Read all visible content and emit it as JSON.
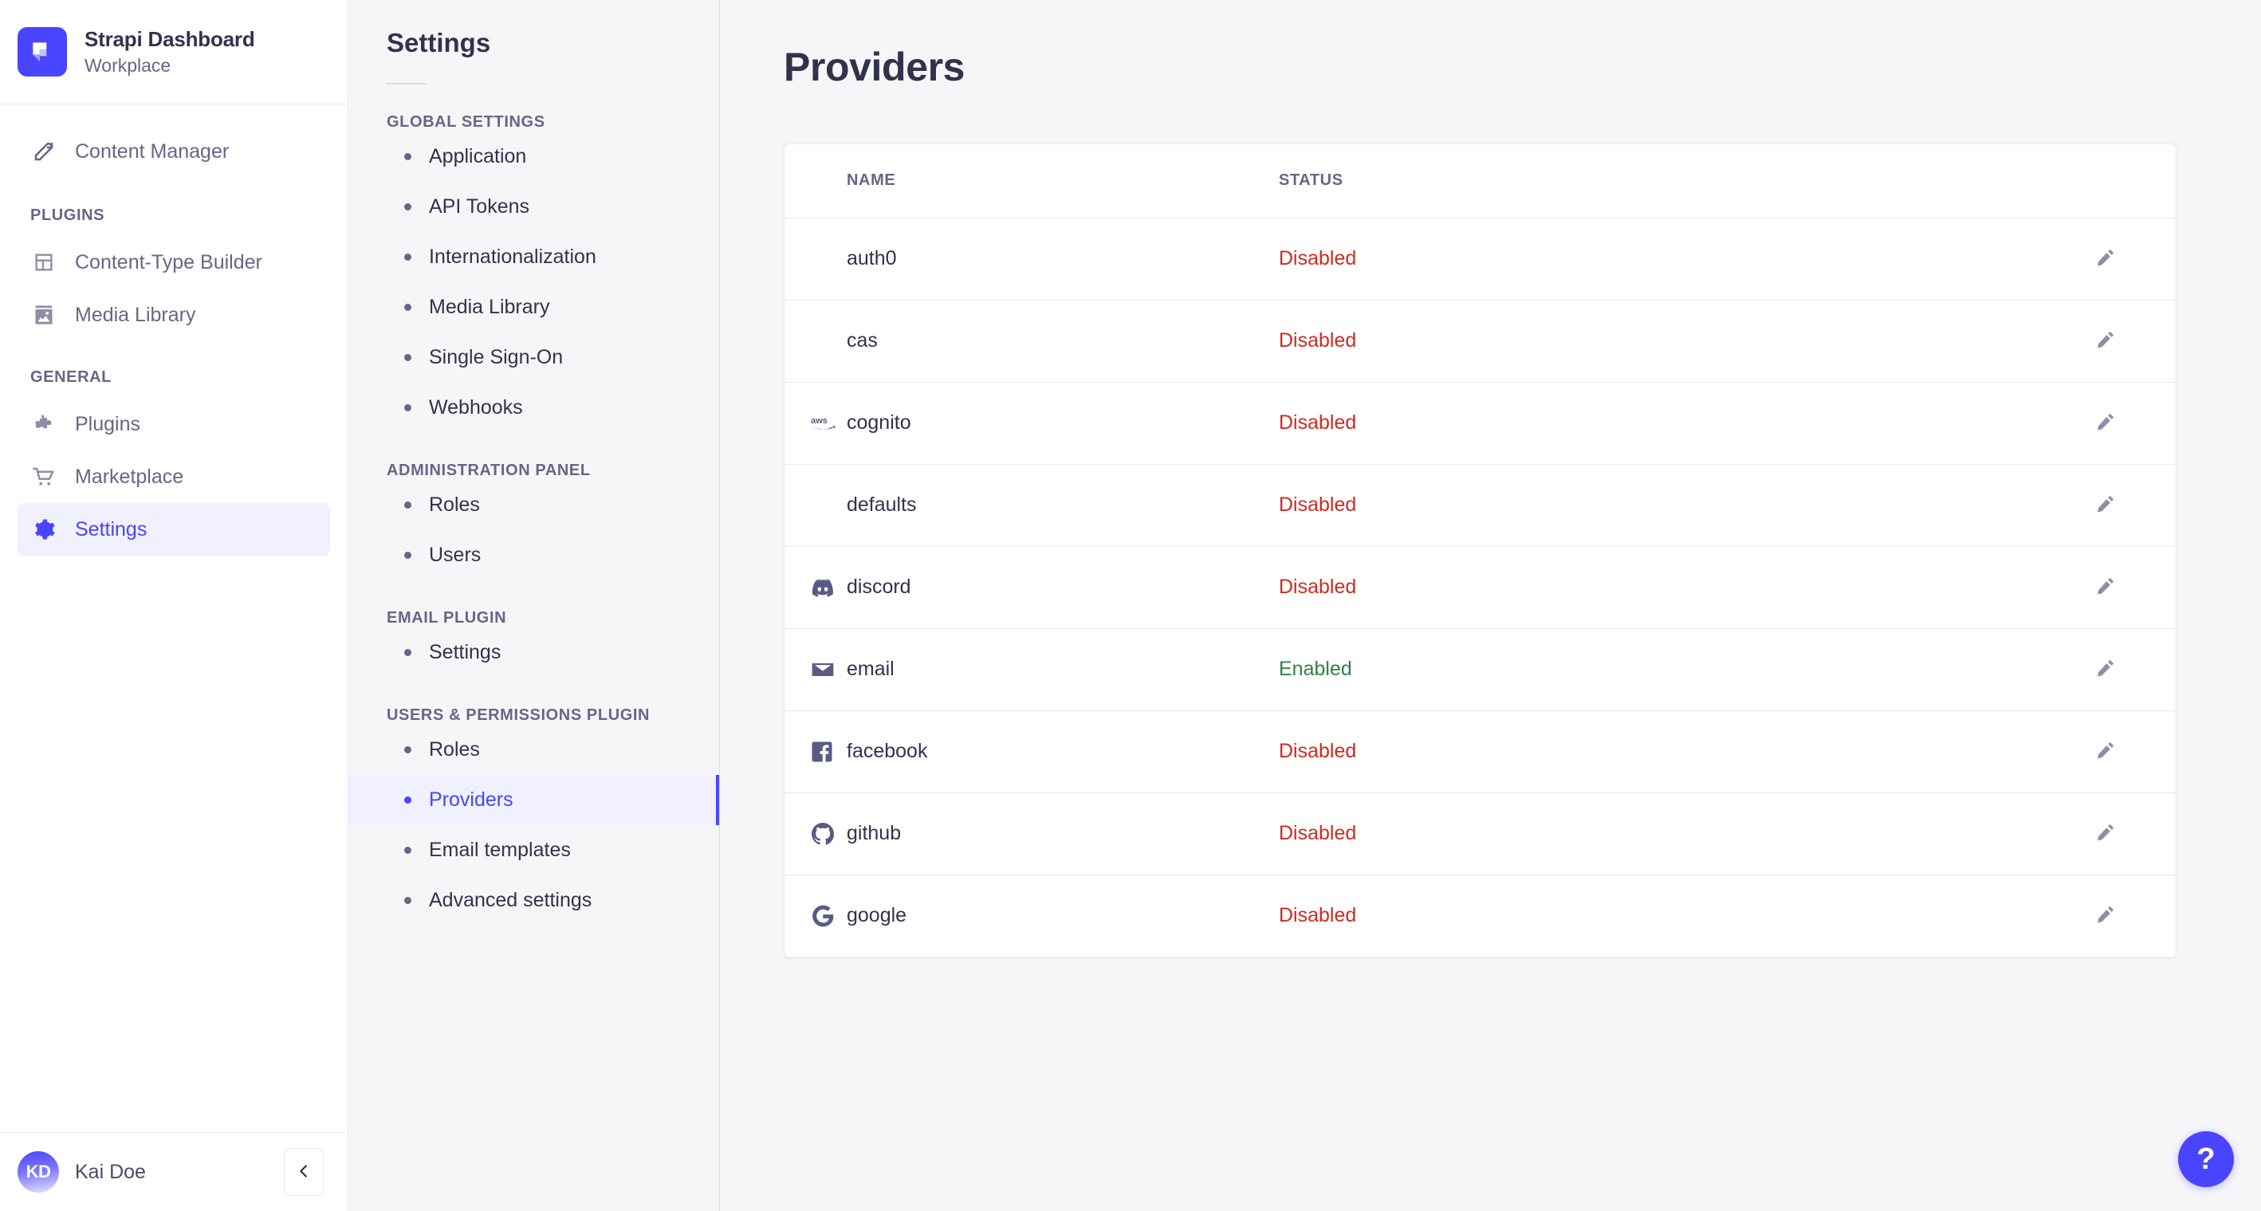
{
  "brand": {
    "title": "Strapi Dashboard",
    "subtitle": "Workplace",
    "logo_color": "#4945ff"
  },
  "sidebar": {
    "main_items": [
      {
        "label": "Content Manager",
        "icon": "feather-pen-icon",
        "active": false
      }
    ],
    "groups": [
      {
        "label": "PLUGINS",
        "items": [
          {
            "label": "Content-Type Builder",
            "icon": "layout-grid-icon",
            "active": false
          },
          {
            "label": "Media Library",
            "icon": "image-icon",
            "active": false
          }
        ]
      },
      {
        "label": "GENERAL",
        "items": [
          {
            "label": "Plugins",
            "icon": "puzzle-icon",
            "active": false
          },
          {
            "label": "Marketplace",
            "icon": "shopping-cart-icon",
            "active": false
          },
          {
            "label": "Settings",
            "icon": "gear-icon",
            "active": true
          }
        ]
      }
    ],
    "user": {
      "initials": "KD",
      "name": "Kai Doe"
    },
    "collapse_icon": "chevron-left-icon"
  },
  "subnav": {
    "title": "Settings",
    "groups": [
      {
        "label": "GLOBAL SETTINGS",
        "items": [
          {
            "label": "Application",
            "active": false
          },
          {
            "label": "API Tokens",
            "active": false
          },
          {
            "label": "Internationalization",
            "active": false
          },
          {
            "label": "Media Library",
            "active": false
          },
          {
            "label": "Single Sign-On",
            "active": false
          },
          {
            "label": "Webhooks",
            "active": false
          }
        ]
      },
      {
        "label": "ADMINISTRATION PANEL",
        "items": [
          {
            "label": "Roles",
            "active": false
          },
          {
            "label": "Users",
            "active": false
          }
        ]
      },
      {
        "label": "EMAIL PLUGIN",
        "items": [
          {
            "label": "Settings",
            "active": false
          }
        ]
      },
      {
        "label": "USERS & PERMISSIONS PLUGIN",
        "items": [
          {
            "label": "Roles",
            "active": false
          },
          {
            "label": "Providers",
            "active": true
          },
          {
            "label": "Email templates",
            "active": false
          },
          {
            "label": "Advanced settings",
            "active": false
          }
        ]
      }
    ]
  },
  "main": {
    "page_title": "Providers",
    "table": {
      "columns": [
        "NAME",
        "STATUS"
      ],
      "edit_icon": "pencil-icon",
      "rows": [
        {
          "name": "auth0",
          "icon": "",
          "status": "Disabled"
        },
        {
          "name": "cas",
          "icon": "",
          "status": "Disabled"
        },
        {
          "name": "cognito",
          "icon": "aws-icon",
          "status": "Disabled"
        },
        {
          "name": "defaults",
          "icon": "",
          "status": "Disabled"
        },
        {
          "name": "discord",
          "icon": "discord-icon",
          "status": "Disabled"
        },
        {
          "name": "email",
          "icon": "envelope-icon",
          "status": "Enabled"
        },
        {
          "name": "facebook",
          "icon": "facebook-icon",
          "status": "Disabled"
        },
        {
          "name": "github",
          "icon": "github-icon",
          "status": "Disabled"
        },
        {
          "name": "google",
          "icon": "google-icon",
          "status": "Disabled"
        }
      ]
    },
    "help_button": "?"
  },
  "colors": {
    "accent": "#4945ff",
    "accent_bg": "#f0f0ff",
    "danger": "#d02b20",
    "success": "#328048",
    "text": "#32324d",
    "muted": "#666687",
    "page_bg": "#f6f6f9",
    "border": "#eaeaef"
  }
}
